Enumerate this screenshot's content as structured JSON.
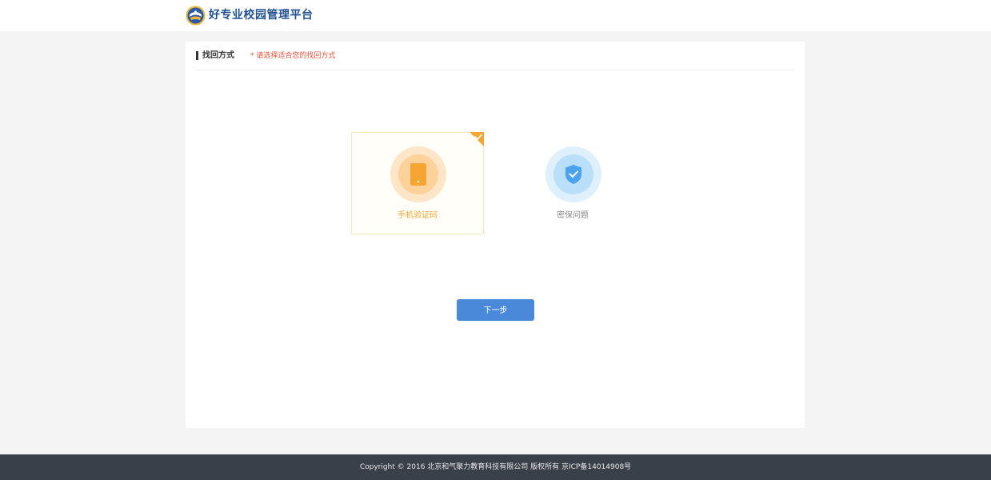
{
  "header": {
    "logo_icon": "school-emblem-icon",
    "brand_title": "好专业校园管理平台",
    "brand_color": "#1f4f8f"
  },
  "section": {
    "title": "找回方式",
    "hint": "* 请选择适合您的找回方式",
    "hint_color": "#f0533b"
  },
  "options": [
    {
      "id": "phone",
      "label": "手机验证码",
      "icon": "mobile-phone-icon",
      "selected": true,
      "accent": "#f5a532"
    },
    {
      "id": "security",
      "label": "密保问题",
      "icon": "shield-check-icon",
      "selected": false,
      "accent": "#4aa3ec"
    }
  ],
  "actions": {
    "next_label": "下一步",
    "next_color": "#4a89d9"
  },
  "footer": {
    "copyright": "Copyright © 2016 北京和气聚力教育科技有限公司 版权所有 京ICP备14014908号"
  }
}
